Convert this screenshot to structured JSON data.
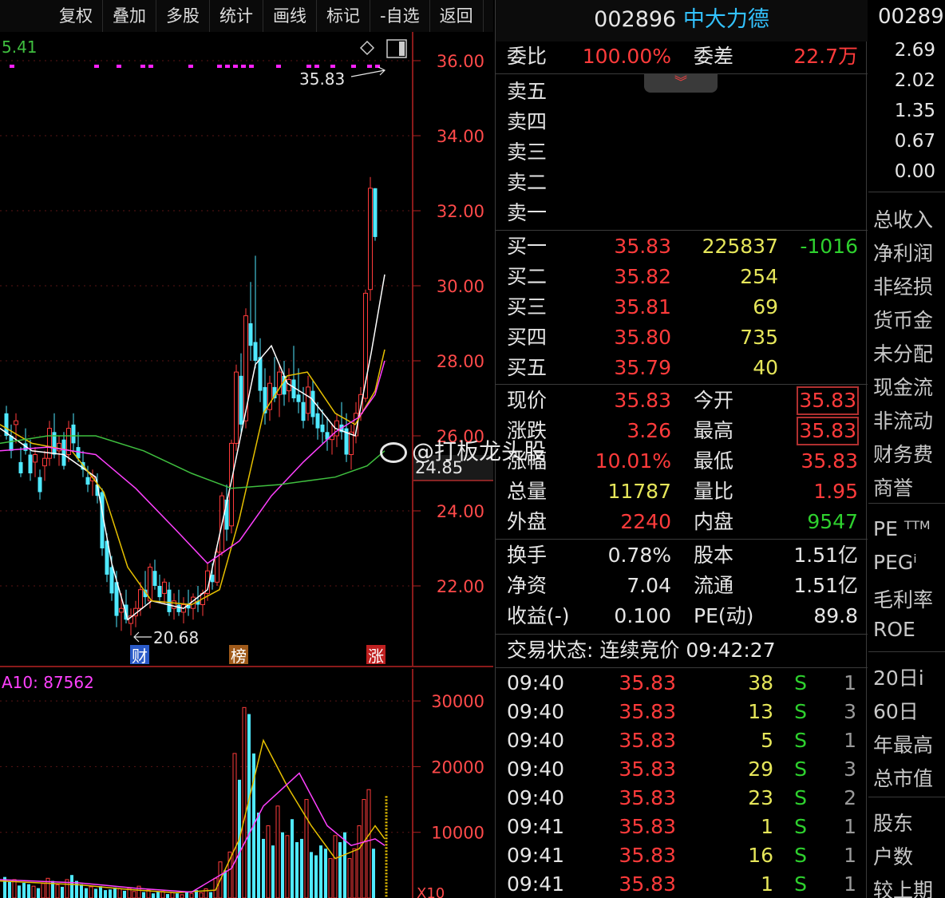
{
  "toolbar": {
    "items": [
      "复权",
      "叠加",
      "多股",
      "统计",
      "画线",
      "标记",
      "-自选",
      "返回"
    ]
  },
  "chart": {
    "ma_label": "5.41",
    "high_annotation": "35.83",
    "low_annotation": "20.68",
    "last_price_tag": "24.85",
    "price_axis": [
      "36.00",
      "34.00",
      "32.00",
      "30.00",
      "28.00",
      "26.00",
      "24.00",
      "22.00"
    ],
    "markers": [
      {
        "text": "财",
        "color": "#2a5ac8"
      },
      {
        "text": "榜",
        "color": "#a05a1a"
      },
      {
        "text": "涨",
        "color": "#c02020"
      }
    ],
    "volume_label": "A10: 87562",
    "volume_axis": [
      "30000",
      "20000",
      "10000"
    ],
    "volume_unit": "X10"
  },
  "quote": {
    "code": "002896",
    "name": "中大力德",
    "ratio_label": "委比",
    "ratio_value": "100.00%",
    "diff_label": "委差",
    "diff_value": "22.7万",
    "sell": [
      {
        "label": "卖五"
      },
      {
        "label": "卖四"
      },
      {
        "label": "卖三"
      },
      {
        "label": "卖二"
      },
      {
        "label": "卖一"
      }
    ],
    "buy": [
      {
        "label": "买一",
        "price": "35.83",
        "vol": "225837",
        "chg": "-1016"
      },
      {
        "label": "买二",
        "price": "35.82",
        "vol": "254",
        "chg": ""
      },
      {
        "label": "买三",
        "price": "35.81",
        "vol": "69",
        "chg": ""
      },
      {
        "label": "买四",
        "price": "35.80",
        "vol": "735",
        "chg": ""
      },
      {
        "label": "买五",
        "price": "35.79",
        "vol": "40",
        "chg": ""
      }
    ],
    "stats": [
      {
        "l1": "现价",
        "v1": "35.83",
        "c1": "red",
        "l2": "今开",
        "v2": "35.83",
        "c2": "red",
        "box": true
      },
      {
        "l1": "涨跌",
        "v1": "3.26",
        "c1": "red",
        "l2": "最高",
        "v2": "35.83",
        "c2": "red",
        "box": true
      },
      {
        "l1": "涨幅",
        "v1": "10.01%",
        "c1": "red",
        "l2": "最低",
        "v2": "35.83",
        "c2": "red",
        "box": false
      },
      {
        "l1": "总量",
        "v1": "11787",
        "c1": "yel",
        "l2": "量比",
        "v2": "1.95",
        "c2": "red",
        "box": false
      },
      {
        "l1": "外盘",
        "v1": "2240",
        "c1": "red",
        "l2": "内盘",
        "v2": "9547",
        "c2": "grn",
        "box": false
      }
    ],
    "fund": [
      {
        "l1": "换手",
        "v1": "0.78%",
        "l2": "股本",
        "v2": "1.51亿"
      },
      {
        "l1": "净资",
        "v1": "7.04",
        "l2": "流通",
        "v2": "1.51亿"
      },
      {
        "l1": "收益(-)",
        "v1": "0.100",
        "l2": "PE(动)",
        "v2": "89.8"
      }
    ],
    "status": "交易状态: 连续竞价 09:42:27",
    "ticks": [
      {
        "t": "09:40",
        "p": "35.83",
        "v": "38",
        "s": "S",
        "n": "1"
      },
      {
        "t": "09:40",
        "p": "35.83",
        "v": "13",
        "s": "S",
        "n": "3"
      },
      {
        "t": "09:40",
        "p": "35.83",
        "v": "5",
        "s": "S",
        "n": "1"
      },
      {
        "t": "09:40",
        "p": "35.83",
        "v": "29",
        "s": "S",
        "n": "3"
      },
      {
        "t": "09:40",
        "p": "35.83",
        "v": "23",
        "s": "S",
        "n": "2"
      },
      {
        "t": "09:41",
        "p": "35.83",
        "v": "1",
        "s": "S",
        "n": "1"
      },
      {
        "t": "09:41",
        "p": "35.83",
        "v": "16",
        "s": "S",
        "n": "1"
      },
      {
        "t": "09:41",
        "p": "35.83",
        "v": "1",
        "s": "S",
        "n": "1"
      }
    ]
  },
  "side": {
    "code": "00289",
    "numbers": [
      "2.69",
      "2.02",
      "1.35",
      "0.67",
      "0.00"
    ],
    "labels": [
      "总收入",
      "净利润",
      "非经损",
      "货币金",
      "未分配",
      "现金流",
      "非流动",
      "财务费",
      "商誉",
      "PE ᵀᵀᴹ",
      "PEGⁱ",
      "毛利率",
      "ROE",
      "20日i",
      "60日",
      "年最高",
      "总市值",
      "股东",
      "户数",
      "较上期"
    ]
  },
  "watermark": {
    "text": "@打板龙头股"
  }
}
